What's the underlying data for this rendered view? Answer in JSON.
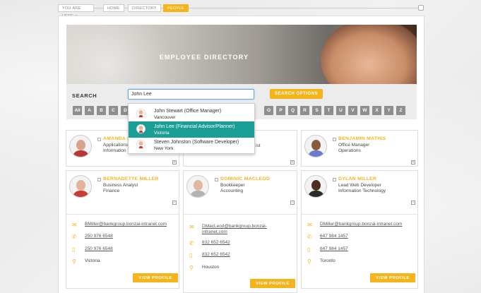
{
  "breadcrumb": {
    "prefix": "YOU ARE HERE >",
    "items": [
      "HOME",
      "DIRECTORY",
      "PEOPLE"
    ]
  },
  "hero": {
    "title": "EMPLOYEE DIRECTORY"
  },
  "search": {
    "label": "SEARCH",
    "value": "John Lee",
    "options_label": "SEARCH OPTIONS"
  },
  "letters": [
    "All",
    "A",
    "B",
    "C",
    "D",
    "O",
    "P",
    "Q",
    "R",
    "S",
    "T",
    "U",
    "V",
    "W",
    "X",
    "Y",
    "Z"
  ],
  "dropdown": [
    {
      "name": "John Stewart (Office Manager)",
      "city": "Vancouver"
    },
    {
      "name": "John Lee (Financial Advisor/Planner)",
      "city": "Victoria"
    },
    {
      "name": "Steven Johnston (Software Developer)",
      "city": "New York"
    }
  ],
  "top_cards": [
    {
      "name": "AMANDA M",
      "title": "Applications",
      "dept": "Information"
    },
    {
      "name": "",
      "title": "ist",
      "dept": ""
    },
    {
      "name": "BENJAMIN MATHIS",
      "title": "Office Manager",
      "dept": "Operations"
    }
  ],
  "cards": [
    {
      "name": "BERNADETTE MILLER",
      "title": "Business Analyst",
      "dept": "Finance",
      "email": "BMiller@bankgroup.bonzai-intranet.com",
      "phone": "250 976 6548",
      "mobile": "250 976 6548",
      "city": "Victoria",
      "button": "VIEW PROFILE"
    },
    {
      "name": "DOMINIC MACLEOD",
      "title": "Bookkeeper",
      "dept": "Accounting",
      "email": "DMacLeod@bankgroup.bonzai-intranet.com",
      "phone": "832 652 6542",
      "mobile": "832 652 6542",
      "city": "Houston",
      "button": "VIEW PROFILE"
    },
    {
      "name": "DYLAN MILLER",
      "title": "Lead Web Developer",
      "dept": "Information Technology",
      "email": "DMiller@bankgroup.bonzai-intranet.com",
      "phone": "647 984 1457",
      "mobile": "647 984 1457",
      "city": "Toronto",
      "button": "VIEW PROFILE"
    }
  ],
  "colors": {
    "accent": "#f4b41a",
    "highlight": "#1a9e96"
  }
}
